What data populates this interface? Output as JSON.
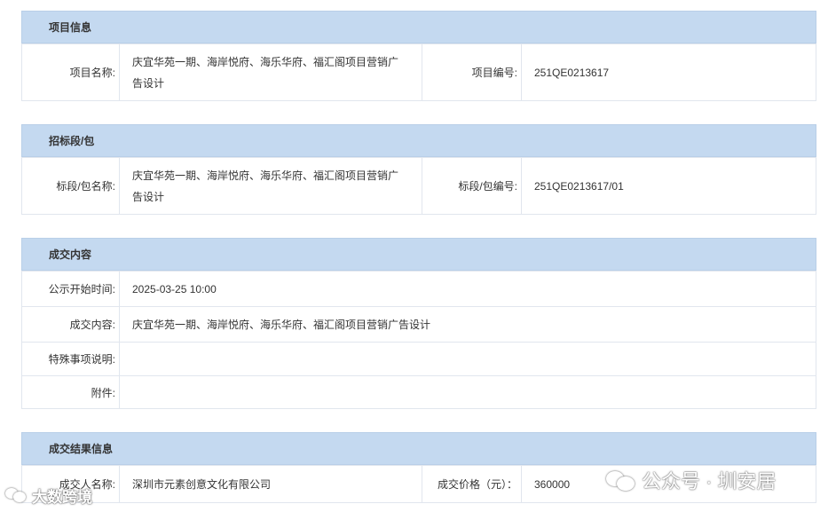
{
  "project_info": {
    "title": "项目信息",
    "name_label": "项目名称:",
    "name_value_line1": "庆宜华苑一期、海岸悦府、海乐华府、福汇阁项目营销广",
    "name_value_line2": "告设计",
    "code_label": "项目编号:",
    "code_value": "251QE0213617"
  },
  "lot_info": {
    "title": "招标段/包",
    "name_label": "标段/包名称:",
    "name_value_line1": "庆宜华苑一期、海岸悦府、海乐华府、福汇阁项目营销广",
    "name_value_line2": "告设计",
    "code_label": "标段/包编号:",
    "code_value": "251QE0213617/01"
  },
  "deal_content": {
    "title": "成交内容",
    "rows": [
      {
        "label": "公示开始时间:",
        "value": "2025-03-25 10:00"
      },
      {
        "label": "成交内容:",
        "value": "庆宜华苑一期、海岸悦府、海乐华府、福汇阁项目营销广告设计"
      },
      {
        "label": "特殊事项说明:",
        "value": ""
      },
      {
        "label": "附件:",
        "value": ""
      }
    ]
  },
  "deal_result": {
    "title": "成交结果信息",
    "winner_label": "成交人名称:",
    "winner_value": "深圳市元素创意文化有限公司",
    "price_label": "成交价格（元）：",
    "price_value": "360000"
  },
  "watermarks": {
    "right_text": "公众号 · 圳安居",
    "left_text": "大数跨境"
  }
}
